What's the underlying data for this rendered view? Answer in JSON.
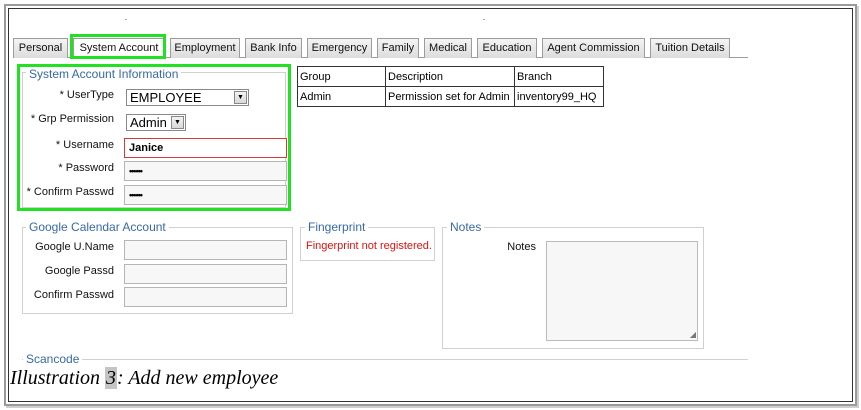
{
  "tabs": [
    {
      "label": "Personal",
      "active": false
    },
    {
      "label": "System Account",
      "active": true
    },
    {
      "label": "Employment",
      "active": false
    },
    {
      "label": "Bank Info",
      "active": false
    },
    {
      "label": "Emergency",
      "active": false
    },
    {
      "label": "Family",
      "active": false
    },
    {
      "label": "Medical",
      "active": false
    },
    {
      "label": "Education",
      "active": false
    },
    {
      "label": "Agent Commission",
      "active": false
    },
    {
      "label": "Tuition Details",
      "active": false
    }
  ],
  "system_account": {
    "legend": "System Account Information",
    "usertype_label": "* UserType",
    "usertype_value": "EMPLOYEE",
    "grp_permission_label": "* Grp Permission",
    "grp_permission_value": "Admin",
    "username_label": "* Username",
    "username_value": "Janice",
    "password_label": "* Password",
    "password_value": "••••••",
    "confirm_label": "* Confirm Passwd",
    "confirm_value": "••••••"
  },
  "group_table": {
    "headers": [
      "Group",
      "Description",
      "Branch"
    ],
    "rows": [
      [
        "Admin",
        "Permission set for Admin",
        "inventory99_HQ"
      ]
    ]
  },
  "google_calendar": {
    "legend": "Google Calendar Account",
    "uname_label": "Google U.Name",
    "passd_label": "Google Passd",
    "confirm_label": "Confirm Passwd"
  },
  "fingerprint": {
    "legend": "Fingerprint",
    "status": "Fingerprint not registered."
  },
  "notes": {
    "legend": "Notes",
    "label": "Notes"
  },
  "scancode": {
    "legend": "Scancode"
  },
  "caption": {
    "prefix": "Illustration ",
    "number": "3",
    "suffix": ": Add new employee"
  },
  "colors": {
    "highlight": "#22e022",
    "legend_text": "#3869a5",
    "error_text": "#dd1111"
  }
}
